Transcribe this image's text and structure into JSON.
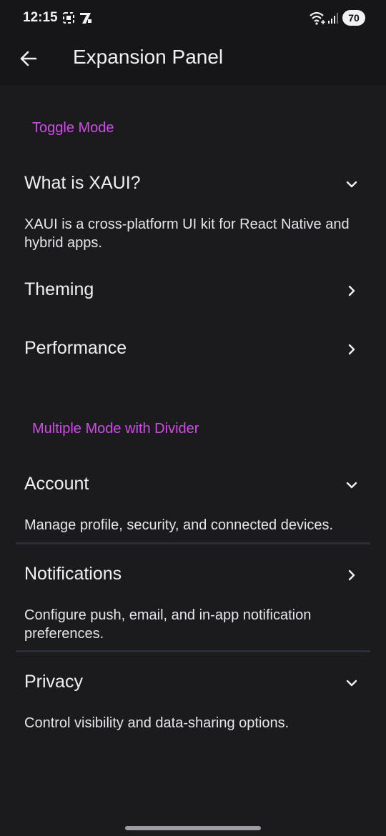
{
  "status_bar": {
    "time": "12:15",
    "battery": "70",
    "icons": [
      "screenshot-icon",
      "app-notification-icon",
      "wifi-icon",
      "signal-icon"
    ]
  },
  "app_bar": {
    "title": "Expansion Panel",
    "back_icon": "arrow-left-icon"
  },
  "sections": {
    "toggle": {
      "label": "Toggle Mode",
      "panels": [
        {
          "title": "What is XAUI?",
          "expanded": true,
          "body": "XAUI is a cross-platform UI kit for React Native and hybrid apps."
        },
        {
          "title": "Theming",
          "expanded": false
        },
        {
          "title": "Performance",
          "expanded": false
        }
      ]
    },
    "multiple": {
      "label": "Multiple Mode with Divider",
      "panels": [
        {
          "title": "Account",
          "expanded": true,
          "body": "Manage profile, security, and connected devices."
        },
        {
          "title": "Notifications",
          "expanded": false,
          "body": "Configure push, email, and in-app notification preferences."
        },
        {
          "title": "Privacy",
          "expanded": true,
          "body": "Control visibility and data-sharing options."
        }
      ]
    }
  },
  "colors": {
    "background": "#1b1b1e",
    "accent": "#d04be8",
    "text": "#f0f0f3",
    "divider": "#2a2d3a"
  }
}
